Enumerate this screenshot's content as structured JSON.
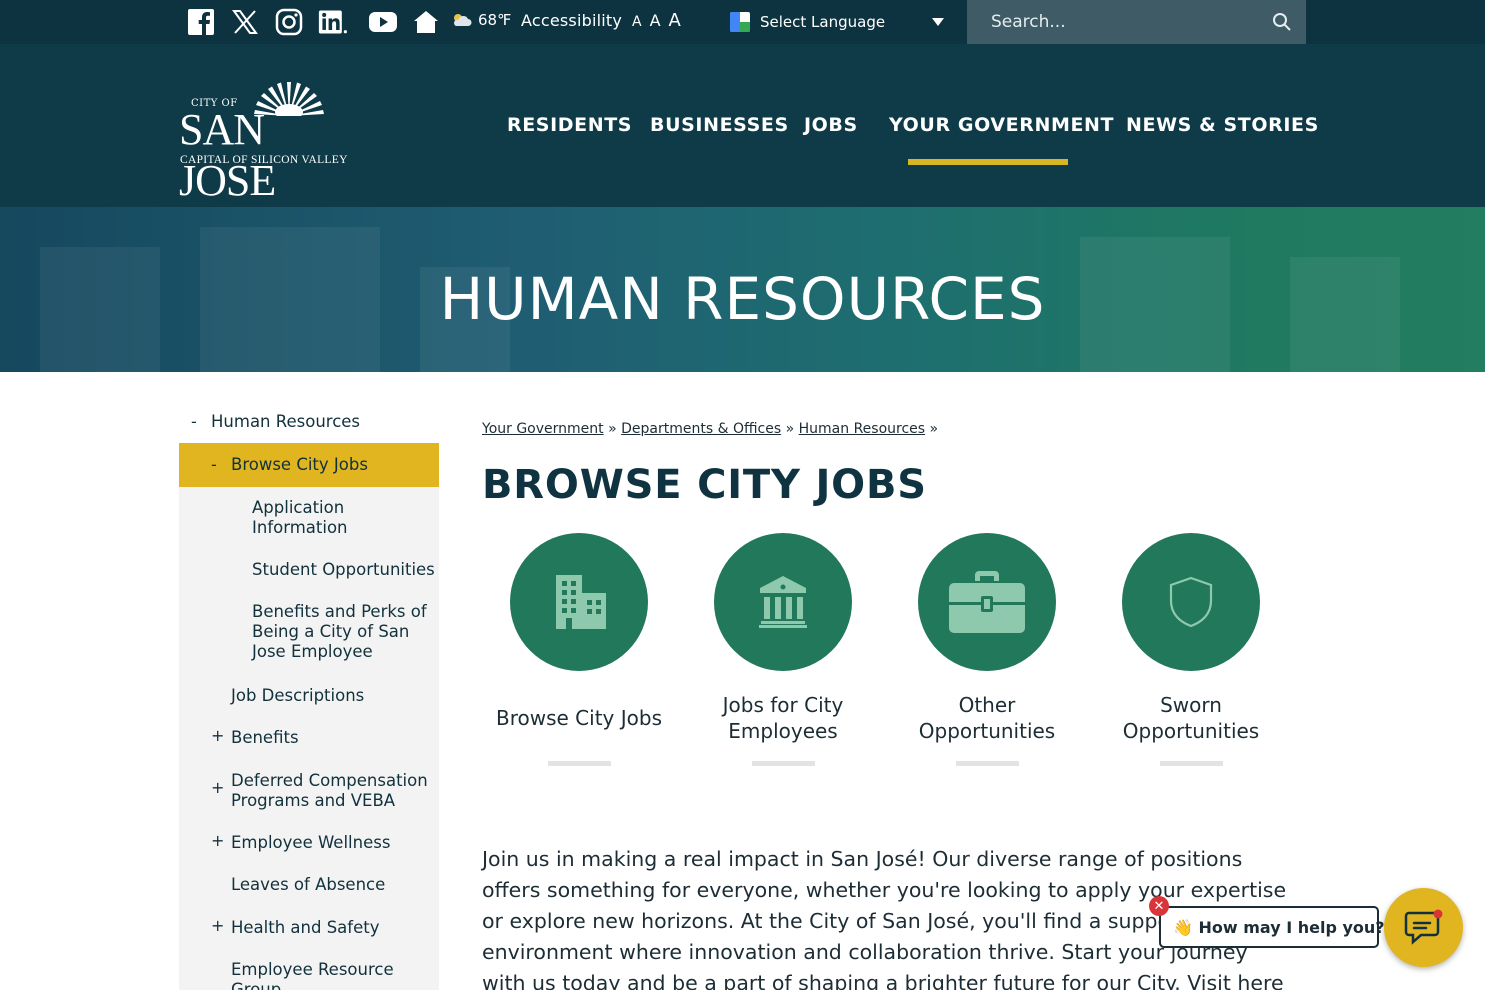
{
  "utility": {
    "social": [
      "facebook-icon",
      "x-icon",
      "instagram-icon",
      "linkedin-icon",
      "youtube-icon",
      "home-icon"
    ],
    "weather": "68℉",
    "accessibility": "Accessibility",
    "font_sizes": [
      "A",
      "A",
      "A"
    ],
    "language": "Select Language",
    "search_placeholder": "Search..."
  },
  "header": {
    "logo": {
      "city_of": "CITY OF",
      "name": "SAN JOSE",
      "tagline": "CAPITAL OF SILICON VALLEY"
    },
    "nav": [
      "RESIDENTS",
      "BUSINESSES",
      "JOBS",
      "YOUR GOVERNMENT",
      "NEWS & STORIES"
    ],
    "active_nav": "YOUR GOVERNMENT",
    "accent_color": "#d8b623"
  },
  "banner": {
    "title": "HUMAN RESOURCES"
  },
  "sidebar": {
    "top": "Human Resources",
    "active": "Browse City Jobs",
    "sub_items": [
      "Application Information",
      "Student Opportunities",
      "Benefits and Perks of Being a City of San Jose Employee"
    ],
    "items": [
      {
        "label": "Job Descriptions",
        "mark": ""
      },
      {
        "label": "Benefits",
        "mark": "+"
      },
      {
        "label": "Deferred Compensation Programs and VEBA",
        "mark": "+"
      },
      {
        "label": "Employee Wellness",
        "mark": "+"
      },
      {
        "label": "Leaves of Absence",
        "mark": ""
      },
      {
        "label": "Health and Safety",
        "mark": "+"
      },
      {
        "label": "Employee Resource Group",
        "mark": ""
      }
    ],
    "collapse_mark": "-"
  },
  "breadcrumb": [
    "Your Government",
    "Departments & Offices",
    "Human Resources"
  ],
  "breadcrumb_sep": "»",
  "page_title": "BROWSE CITY JOBS",
  "tiles": [
    {
      "label": "Browse City Jobs",
      "icon": "building-icon"
    },
    {
      "label": "Jobs for City Employees",
      "icon": "government-building-icon"
    },
    {
      "label": "Other Opportunities",
      "icon": "toolbox-icon"
    },
    {
      "label": "Sworn Opportunities",
      "icon": "shield-icon"
    }
  ],
  "intro": "Join us in making a real impact in San José! Our diverse range of positions offers something for everyone, whether you're looking to apply your expertise or explore new horizons. At the City of San José, you'll find a supportive environment where innovation and collaboration thrive. Start your journey with us today and be a part of shaping a brighter future for our City. Visit here to learn more about our One",
  "chat": {
    "prompt": "👋 How may I help you?",
    "close": "✕"
  }
}
